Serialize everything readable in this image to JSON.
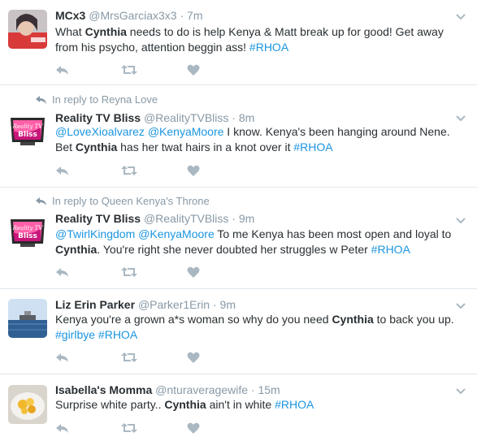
{
  "colors": {
    "name_text": "#292f33",
    "meta_text": "#8899a6",
    "link": "#1b95e0",
    "icon": "#aab8c2",
    "divider": "#e1e8ed"
  },
  "tweets": [
    {
      "avatar_icon": "user-avatar",
      "reply_context": "",
      "name": "MCx3",
      "handle": "@MrsGarciax3x3",
      "time": "7m",
      "lines": [
        [
          {
            "t": "What "
          },
          {
            "t": "Cynthia",
            "hl": true
          },
          {
            "t": " needs to do is help Kenya & Matt break up for good! Get away"
          }
        ],
        [
          {
            "t": "from his psycho, attention beggin ass! "
          },
          {
            "t": "#RHOA",
            "link": true
          }
        ]
      ]
    },
    {
      "avatar_icon": "reality-tv-bliss-logo",
      "reply_context": "In reply to Reyna Love",
      "name": "Reality TV Bliss",
      "handle": "@RealityTVBliss",
      "time": "8m",
      "lines": [
        [
          {
            "t": "@LoveXioalvarez",
            "link": true
          },
          {
            "t": " "
          },
          {
            "t": "@KenyaMoore",
            "link": true
          },
          {
            "t": " I know. Kenya's been hanging around Nene."
          }
        ],
        [
          {
            "t": "Bet "
          },
          {
            "t": "Cynthia",
            "hl": true
          },
          {
            "t": " has her twat hairs in a knot over it "
          },
          {
            "t": "#RHOA",
            "link": true
          }
        ]
      ]
    },
    {
      "avatar_icon": "reality-tv-bliss-logo",
      "reply_context": "In reply to Queen Kenya's Throne",
      "name": "Reality TV Bliss",
      "handle": "@RealityTVBliss",
      "time": "9m",
      "lines": [
        [
          {
            "t": "@TwirlKingdom",
            "link": true
          },
          {
            "t": " "
          },
          {
            "t": "@KenyaMoore",
            "link": true
          },
          {
            "t": " To me Kenya has been most open and loyal to"
          }
        ],
        [
          {
            "t": "Cynthia",
            "hl": true
          },
          {
            "t": ". You're right she never doubted her struggles w Peter "
          },
          {
            "t": "#RHOA",
            "link": true
          }
        ]
      ]
    },
    {
      "avatar_icon": "ship-photo-avatar",
      "reply_context": "",
      "name": "Liz Erin Parker",
      "handle": "@Parker1Erin",
      "time": "9m",
      "lines": [
        [
          {
            "t": "Kenya you're a grown a*s woman so why do you need "
          },
          {
            "t": "Cynthia",
            "hl": true
          },
          {
            "t": " to back you up."
          }
        ],
        [
          {
            "t": "#girlbye",
            "link": true
          },
          {
            "t": " "
          },
          {
            "t": "#RHOA",
            "link": true
          }
        ]
      ]
    },
    {
      "avatar_icon": "food-plate-avatar",
      "reply_context": "",
      "name": "Isabella's Momma",
      "handle": "@nturaveragewife",
      "time": "15m",
      "lines": [
        [
          {
            "t": "Surprise white party.. "
          },
          {
            "t": "Cynthia",
            "hl": true
          },
          {
            "t": " ain't in white "
          },
          {
            "t": "#RHOA",
            "link": true
          }
        ]
      ]
    }
  ],
  "icons": {
    "reply": "reply-arrow-icon",
    "retweet": "retweet-icon",
    "like": "heart-icon",
    "more": "chevron-down-icon",
    "reply_context": "reply-context-arrow-icon"
  },
  "hidden_text": {
    "brand_mark_a": "Reality TV",
    "brand_mark_b": "Bliss"
  }
}
